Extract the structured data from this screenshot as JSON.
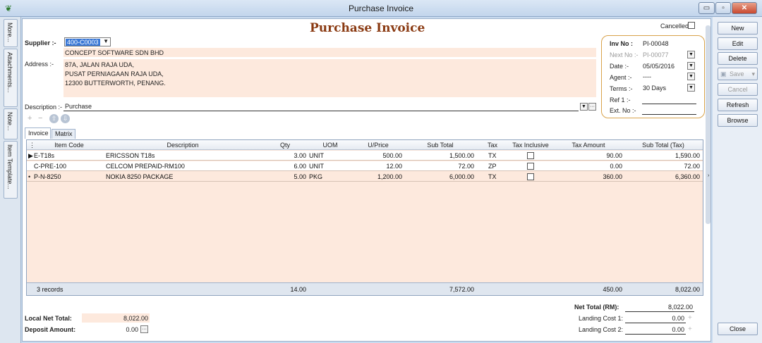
{
  "window": {
    "title": "Purchase Invoice",
    "minimize": "▭",
    "restore": "▫",
    "close": "✕",
    "app_icon": "❦"
  },
  "side_tabs": [
    "More...",
    "Attachments...",
    "Note...",
    "Item Template..."
  ],
  "header": {
    "title": "Purchase Invoice",
    "cancelled_label": "Cancelled"
  },
  "supplier": {
    "label": "Supplier :-",
    "code": "400-C0003",
    "name": "CONCEPT SOFTWARE SDN BHD",
    "address_label": "Address :-",
    "address": [
      "87A, JALAN RAJA UDA,",
      "PUSAT PERNIAGAAN RAJA UDA,",
      "12300 BUTTERWORTH, PENANG."
    ]
  },
  "description": {
    "label": "Description :-",
    "value": "Purchase",
    "more": "···"
  },
  "toolbar_icons": [
    "plus-icon",
    "minus-icon",
    "arrow-up-icon",
    "arrow-down-icon"
  ],
  "toolbar_glyphs": {
    "plus": "+",
    "minus": "−",
    "up": "⇧",
    "down": "⇩"
  },
  "tabs": [
    "Invoice",
    "Matrix"
  ],
  "invoice_info": {
    "inv_no_label": "Inv No :",
    "inv_no": "PI-00048",
    "next_no_label": "Next No :-",
    "next_no": "PI-00077",
    "date_label": "Date :-",
    "date": "05/05/2016",
    "agent_label": "Agent :-",
    "agent": "----",
    "terms_label": "Terms :-",
    "terms": "30 Days",
    "ref1_label": "Ref 1 :-",
    "ref1": "",
    "ext_no_label": "Ext. No :-",
    "ext_no": ""
  },
  "grid": {
    "columns": [
      "Item Code",
      "Description",
      "Qty",
      "UOM",
      "U/Price",
      "Sub Total",
      "Tax",
      "Tax Inclusive",
      "Tax Amount",
      "Sub Total (Tax)"
    ],
    "rows": [
      {
        "marker": "▶",
        "item_code": "E-T18s",
        "description": "ERICSSON T18s",
        "qty": "3.00",
        "uom": "UNIT",
        "uprice": "500.00",
        "subtotal": "1,500.00",
        "tax": "TX",
        "tax_amount": "90.00",
        "subtotal_tax": "1,590.00"
      },
      {
        "marker": "",
        "item_code": "C-PRE-100",
        "description": "CELCOM PREPAID-RM100",
        "qty": "6.00",
        "uom": "UNIT",
        "uprice": "12.00",
        "subtotal": "72.00",
        "tax": "ZP",
        "tax_amount": "0.00",
        "subtotal_tax": "72.00"
      },
      {
        "marker": "•",
        "item_code": "P-N-8250",
        "description": "NOKIA 8250 PACKAGE",
        "qty": "5.00",
        "uom": "PKG",
        "uprice": "1,200.00",
        "subtotal": "6,000.00",
        "tax": "TX",
        "tax_amount": "360.00",
        "subtotal_tax": "6,360.00"
      }
    ],
    "footer": {
      "records": "3 records",
      "qty": "14.00",
      "subtotal": "7,572.00",
      "tax_amount": "450.00",
      "subtotal_tax": "8,022.00"
    }
  },
  "totals": {
    "local_net_total_label": "Local Net Total:",
    "local_net_total": "8,022.00",
    "deposit_label": "Deposit Amount:",
    "deposit": "0.00",
    "net_total_label": "Net Total (RM):",
    "net_total": "8,022.00",
    "landing1_label": "Landing Cost 1:",
    "landing1": "0.00",
    "landing2_label": "Landing Cost 2:",
    "landing2": "0.00"
  },
  "actions": {
    "new": "New",
    "edit": "Edit",
    "delete": "Delete",
    "save": "Save",
    "cancel": "Cancel",
    "refresh": "Refresh",
    "browse": "Browse",
    "close": "Close"
  },
  "colors": {
    "accent_title": "#8a3a12",
    "field_fill": "#fde9dd",
    "selection": "#3a78d6"
  }
}
